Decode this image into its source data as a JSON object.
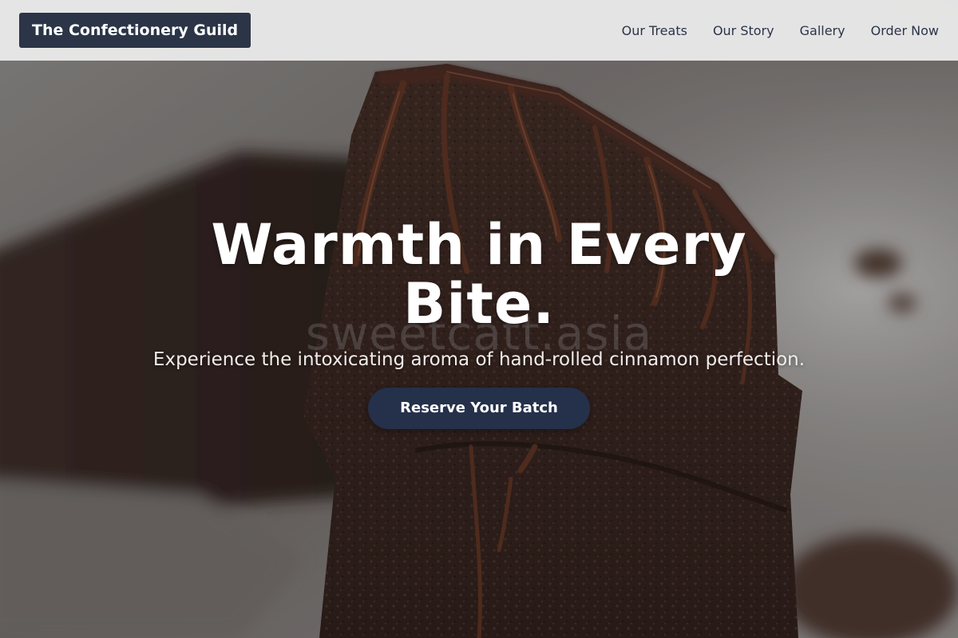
{
  "navbar": {
    "brand": "The Confectionery Guild",
    "links": [
      {
        "label": "Our Treats"
      },
      {
        "label": "Our Story"
      },
      {
        "label": "Gallery"
      },
      {
        "label": "Order Now"
      }
    ]
  },
  "hero": {
    "title": "Warmth in Every Bite.",
    "subtitle": "Experience the intoxicating aroma of hand-rolled cinnamon perfection.",
    "cta_label": "Reserve Your Batch",
    "watermark": "sweetcatt.asia"
  },
  "colors": {
    "accent": "#25304a",
    "brand_bg": "#2b3547",
    "navbar_bg": "#ececec",
    "chocolate": "#3b2620"
  }
}
